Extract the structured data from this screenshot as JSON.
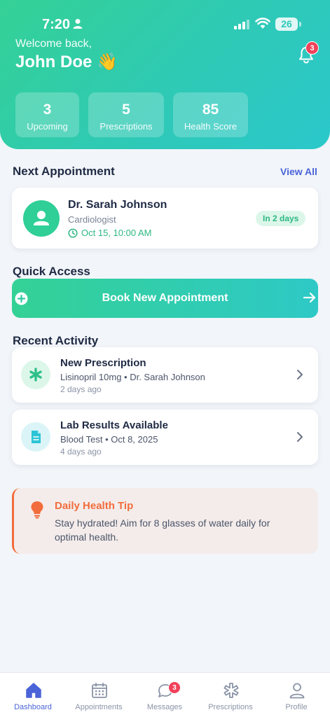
{
  "status_bar": {
    "time": "7:20",
    "battery": "26"
  },
  "header": {
    "welcome": "Welcome back,",
    "user_name": "John Doe 👋",
    "notification_count": "3",
    "stats": [
      {
        "value": "3",
        "label": "Upcoming"
      },
      {
        "value": "5",
        "label": "Prescriptions"
      },
      {
        "value": "85",
        "label": "Health Score"
      }
    ]
  },
  "next_appointment": {
    "title": "Next Appointment",
    "view_all": "View All",
    "doctor": "Dr. Sarah Johnson",
    "specialty": "Cardiologist",
    "datetime": "Oct 15, 10:00 AM",
    "countdown": "In 2 days"
  },
  "quick_access": {
    "title": "Quick Access",
    "book_label": "Book New Appointment"
  },
  "recent_activity": {
    "title": "Recent Activity",
    "items": [
      {
        "title": "New Prescription",
        "detail": "Lisinopril 10mg • Dr. Sarah Johnson",
        "time": "2 days ago",
        "icon": "asterisk-icon"
      },
      {
        "title": "Lab Results Available",
        "detail": "Blood Test • Oct 8, 2025",
        "time": "4 days ago",
        "icon": "document-icon"
      }
    ]
  },
  "health_tip": {
    "title": "Daily Health Tip",
    "body": "Stay hydrated! Aim for 8 glasses of water daily for optimal health."
  },
  "tab_bar": {
    "messages_badge": "3",
    "tabs": [
      {
        "label": "Dashboard",
        "icon": "home-icon"
      },
      {
        "label": "Appointments",
        "icon": "calendar-icon"
      },
      {
        "label": "Messages",
        "icon": "chat-icon"
      },
      {
        "label": "Prescriptions",
        "icon": "medical-icon"
      },
      {
        "label": "Profile",
        "icon": "person-icon"
      }
    ]
  },
  "colors": {
    "brand_green": "#34d196",
    "brand_teal": "#2ec9c6",
    "accent_blue": "#4a63d8",
    "badge_red": "#f2415a",
    "tip_orange": "#f26d3d"
  }
}
